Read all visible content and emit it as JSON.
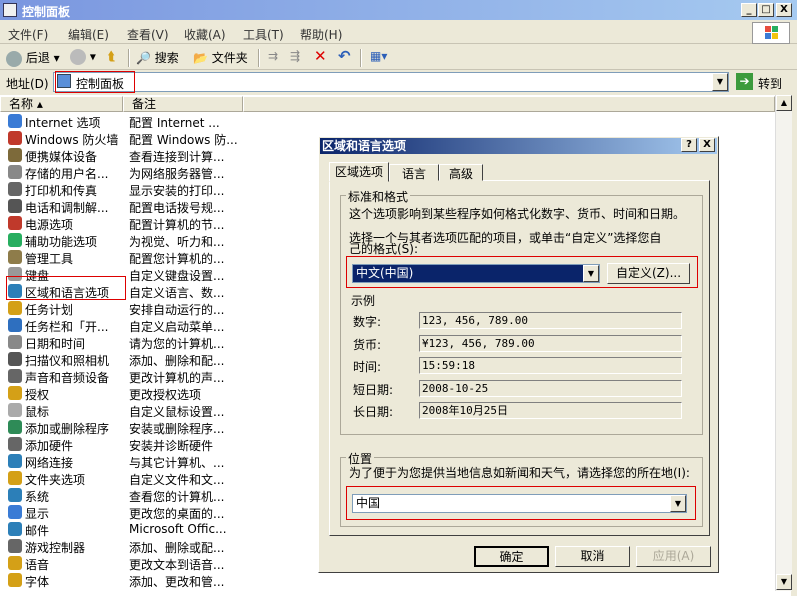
{
  "window": {
    "title": "控制面板",
    "buttons": {
      "minimize": "_",
      "maximize": "□",
      "close": "X"
    }
  },
  "menu": [
    "文件(F)",
    "编辑(E)",
    "查看(V)",
    "收藏(A)",
    "工具(T)",
    "帮助(H)"
  ],
  "toolbar": {
    "back": "后退",
    "search": "搜索",
    "folders": "文件夹"
  },
  "address": {
    "label": "地址(D)",
    "value": "控制面板",
    "go": "转到"
  },
  "list": {
    "columns": [
      "名称",
      "备注"
    ],
    "items": [
      {
        "name": "Internet 选项",
        "comment": "配置 Internet ...",
        "color": "#3a7bd5"
      },
      {
        "name": "Windows 防火墙",
        "comment": "配置 Windows 防...",
        "color": "#c0392b"
      },
      {
        "name": "便携媒体设备",
        "comment": "查看连接到计算...",
        "color": "#7d6a3a"
      },
      {
        "name": "存储的用户名...",
        "comment": "为网络服务器管...",
        "color": "#888"
      },
      {
        "name": "打印机和传真",
        "comment": "显示安装的打印...",
        "color": "#666"
      },
      {
        "name": "电话和调制解...",
        "comment": "配置电话拨号规...",
        "color": "#555"
      },
      {
        "name": "电源选项",
        "comment": "配置计算机的节...",
        "color": "#c0392b"
      },
      {
        "name": "辅助功能选项",
        "comment": "为视觉、听力和...",
        "color": "#27ae60"
      },
      {
        "name": "管理工具",
        "comment": "配置您计算机的...",
        "color": "#8e7c4a"
      },
      {
        "name": "键盘",
        "comment": "自定义键盘设置...",
        "color": "#999"
      },
      {
        "name": "区域和语言选项",
        "comment": "自定义语言、数...",
        "color": "#2c7fb8"
      },
      {
        "name": "任务计划",
        "comment": "安排自动运行的...",
        "color": "#d4a017"
      },
      {
        "name": "任务栏和「开...",
        "comment": "自定义启动菜单...",
        "color": "#2e6fbf"
      },
      {
        "name": "日期和时间",
        "comment": "请为您的计算机...",
        "color": "#888"
      },
      {
        "name": "扫描仪和照相机",
        "comment": "添加、删除和配...",
        "color": "#555"
      },
      {
        "name": "声音和音频设备",
        "comment": "更改计算机的声...",
        "color": "#666"
      },
      {
        "name": "授权",
        "comment": "更改授权选项",
        "color": "#d4a017"
      },
      {
        "name": "鼠标",
        "comment": "自定义鼠标设置...",
        "color": "#aaa"
      },
      {
        "name": "添加或删除程序",
        "comment": "安装或删除程序...",
        "color": "#2e8b57"
      },
      {
        "name": "添加硬件",
        "comment": "安装并诊断硬件",
        "color": "#666"
      },
      {
        "name": "网络连接",
        "comment": "与其它计算机、...",
        "color": "#2c7fb8"
      },
      {
        "name": "文件夹选项",
        "comment": "自定义文件和文...",
        "color": "#d4a017"
      },
      {
        "name": "系统",
        "comment": "查看您的计算机...",
        "color": "#2c7fb8"
      },
      {
        "name": "显示",
        "comment": "更改您的桌面的...",
        "color": "#3a7bd5"
      },
      {
        "name": "邮件",
        "comment": "Microsoft Offic...",
        "color": "#2c7fb8"
      },
      {
        "name": "游戏控制器",
        "comment": "添加、删除或配...",
        "color": "#666"
      },
      {
        "name": "语音",
        "comment": "更改文本到语音...",
        "color": "#d4a017"
      },
      {
        "name": "字体",
        "comment": "添加、更改和管...",
        "color": "#d4a017"
      }
    ]
  },
  "dialog": {
    "title": "区域和语言选项",
    "title_buttons": {
      "help": "?",
      "close": "X"
    },
    "tabs": [
      "区域选项",
      "语言",
      "高级"
    ],
    "standards": {
      "label": "标准和格式",
      "desc": "这个选项影响到某些程序如何格式化数字、货币、时间和日期。",
      "select_desc_line1": "选择一个与其者选项匹配的项目，或单击“自定义”选择您自",
      "select_desc_line2": "己的格式(S):",
      "selected": "中文(中国)",
      "customize": "自定义(Z)..."
    },
    "samples": {
      "label": "示例",
      "rows": [
        {
          "label": "数字:",
          "value": "123, 456, 789.00"
        },
        {
          "label": "货币:",
          "value": "¥123, 456, 789.00"
        },
        {
          "label": "时间:",
          "value": "15:59:18"
        },
        {
          "label": "短日期:",
          "value": "2008-10-25"
        },
        {
          "label": "长日期:",
          "value": "2008年10月25日"
        }
      ]
    },
    "location": {
      "label": "位置",
      "desc": "为了便于为您提供当地信息如新闻和天气，请选择您的所在地(I):",
      "selected": "中国"
    },
    "buttons": {
      "ok": "确定",
      "cancel": "取消",
      "apply": "应用(A)"
    }
  }
}
